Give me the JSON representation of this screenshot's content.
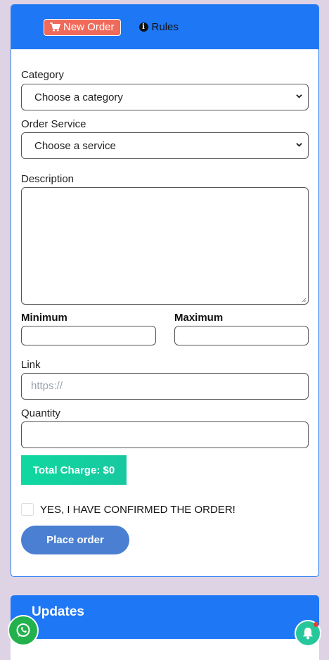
{
  "tabs": {
    "new_order": "New Order",
    "rules": "Rules"
  },
  "icons": {
    "cart": "cart-icon",
    "info": "info-icon",
    "chevron": "chevron-down-icon",
    "whatsapp": "whatsapp-icon",
    "bell": "bell-icon"
  },
  "form": {
    "category_label": "Category",
    "category_value": "Choose a category",
    "service_label": "Order Service",
    "service_value": "Choose a service",
    "description_label": "Description",
    "minimum_label": "Minimum",
    "maximum_label": "Maximum",
    "link_label": "Link",
    "link_placeholder": "https://",
    "quantity_label": "Quantity",
    "total_charge": "Total Charge: $0",
    "confirm_text": "YES, I HAVE CONFIRMED THE ORDER!",
    "place_order": "Place order"
  },
  "updates": {
    "title": "Updates"
  },
  "colors": {
    "header_blue": "#1e77f5",
    "tab_red": "#f06a5b",
    "charge_green": "#0fd8a0",
    "button_blue": "#4a7fd1",
    "whatsapp_green": "#22b14c",
    "bell_teal": "#27c79c"
  }
}
